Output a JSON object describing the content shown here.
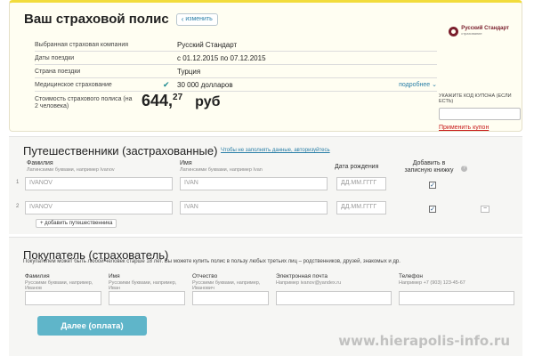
{
  "policy": {
    "title": "Ваш страховой полис",
    "change_label": "изменить",
    "rows": [
      {
        "label": "Выбранная страховая компания",
        "value": "Русский Стандарт"
      },
      {
        "label": "Даты поездки",
        "value": "с 01.12.2015 по 07.12.2015"
      },
      {
        "label": "Страна поездки",
        "value": "Турция"
      },
      {
        "label": "Медицинское страхование",
        "value": "30 000 долларов",
        "more": "подробнее"
      }
    ],
    "cost_label": "Стоимость страхового полиса (на 2 человека)",
    "cost_int": "644,",
    "cost_dec": "27",
    "currency": "руб",
    "logo_name": "Русский Стандарт",
    "logo_sub": "страхование",
    "coupon_label": "УКАЖИТЕ КОД КУПОНА (ЕСЛИ ЕСТЬ)",
    "coupon_apply": "Применить купон"
  },
  "travellers": {
    "title": "Путешественники (застрахованные)",
    "no_fill_link": "Чтобы не заполнять данные, авторизуйтесь",
    "col_lastname": "Фамилия",
    "col_lastname_hint": "Латинскими буквами, например Ivanov",
    "col_firstname": "Имя",
    "col_firstname_hint": "Латинскими буквами, например Ivan",
    "col_birth": "Дата рождения",
    "col_notebook": "Добавить в записную книжку",
    "rows": [
      {
        "num": "1",
        "lastname": "IVANOV",
        "firstname": "IVAN",
        "birth": "ДД.ММ.ГГГГ",
        "check": "✓"
      },
      {
        "num": "2",
        "lastname": "IVANOV",
        "firstname": "IVAN",
        "birth": "ДД.ММ.ГГГГ",
        "check": "✓"
      }
    ],
    "add_button": "+ добавить путешественника",
    "remove_symbol": "−",
    "info_symbol": "?"
  },
  "buyer": {
    "title": "Покупатель (страхователь)",
    "note": "Покупателем может быть любой человек старше 18 лет. Вы можете купить полис в пользу любых третьих лиц – родственников, друзей, знакомых и др.",
    "col_lastname": "Фамилия",
    "col_lastname_hint": "Русскими буквами, например, Иванов",
    "col_firstname": "Имя",
    "col_firstname_hint": "Русскими буквами, например, Иван",
    "col_patronymic": "Отчество",
    "col_patronymic_hint": "Русскими буквами, например, Иванович",
    "col_email": "Электронная почта",
    "col_email_hint": "Например ivanov@yandex.ru",
    "col_phone": "Телефон",
    "col_phone_hint": "Например +7 (903) 123-45-67",
    "next_button": "Далее (оплата)"
  },
  "watermark": "www.hierapolis-info.ru",
  "colors": {
    "accent": "#5fb5c9",
    "link": "#2a7fa7",
    "coupon_link": "#c81a1a",
    "card_bg": "#fffef2",
    "card_border_top": "#f2dc3c",
    "section_bg": "#f6f6f4",
    "logo": "#7a1e2c"
  },
  "icons": {
    "check": "check-icon",
    "chevron": "chevron-down-icon",
    "info": "info-icon",
    "logo": "russian-standard-logo"
  }
}
